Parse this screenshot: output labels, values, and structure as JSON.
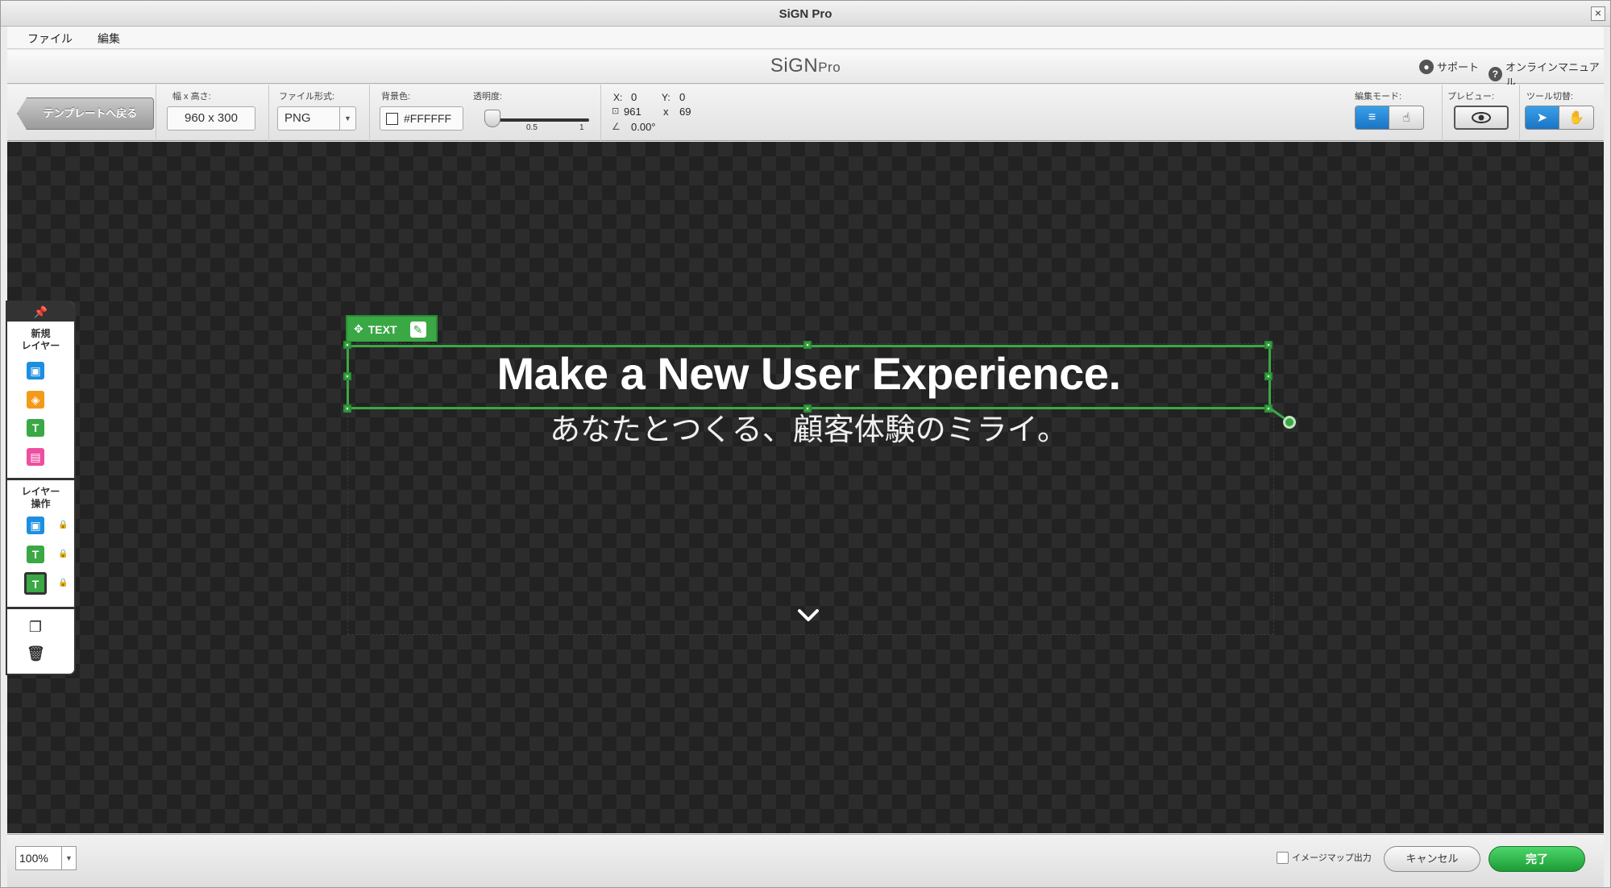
{
  "window": {
    "title": "SiGN Pro"
  },
  "menu": {
    "items": [
      "ファイル",
      "編集"
    ]
  },
  "header": {
    "logo_main": "SiGN",
    "logo_sub": "Pro",
    "support_label": "サポート",
    "manual_label": "オンラインマニュアル"
  },
  "toolbar": {
    "back_label": "テンプレートへ戻る",
    "size_label": "幅 x 高さ:",
    "size_value": "960 x 300",
    "format_label": "ファイル形式:",
    "format_value": "PNG",
    "bgcolor_label": "背景色:",
    "bgcolor_value": "#FFFFFF",
    "opacity_label": "透明度:",
    "opacity_ticks": [
      "0.5",
      "1"
    ],
    "opacity_value": 0,
    "x_label": "X:",
    "x_value": "0",
    "y_label": "Y:",
    "y_value": "0",
    "w_value": "961",
    "h_sep": "x",
    "h_value": "69",
    "angle_value": "0.00°",
    "editmode_label": "編集モード:",
    "preview_label": "プレビュー:",
    "tool_label": "ツール切替:"
  },
  "canvas": {
    "layer_tag": "TEXT",
    "headline": "Make a New User Experience.",
    "subhead": "あなたとつくる、顧客体験のミライ。"
  },
  "leftpanel": {
    "new_layer_title_1": "新規",
    "new_layer_title_2": "レイヤー",
    "layer_ops_title_1": "レイヤー",
    "layer_ops_title_2": "操作",
    "new_icons": [
      {
        "name": "image-layer-icon",
        "color": "#1d8fe0",
        "glyph": "▣"
      },
      {
        "name": "shape-layer-icon",
        "color": "#f39a1a",
        "glyph": "◈"
      },
      {
        "name": "text-layer-icon",
        "color": "#3aa844",
        "glyph": "T"
      },
      {
        "name": "button-layer-icon",
        "color": "#ee4fa0",
        "glyph": "▤"
      }
    ]
  },
  "bottom": {
    "zoom_value": "100%",
    "imagemap_label": "イメージマップ出力",
    "cancel_label": "キャンセル",
    "done_label": "完了"
  },
  "colors": {
    "accent_green": "#3aa844",
    "mode_active_blue": "#1a74c4"
  }
}
